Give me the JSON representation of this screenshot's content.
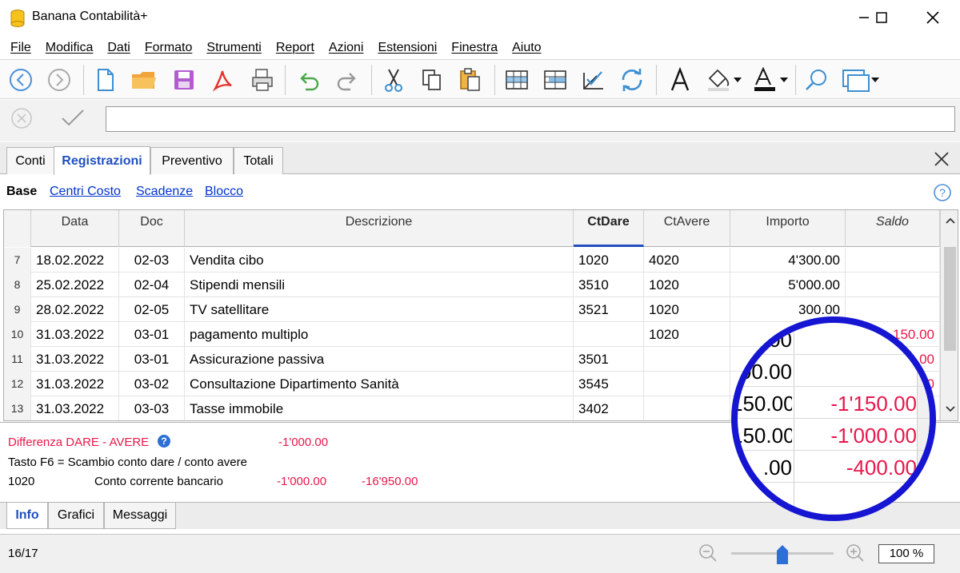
{
  "window": {
    "title": "Banana Contabilità+",
    "minimize_icon": "minimize-icon",
    "maximize_icon": "maximize-icon",
    "close_icon": "close-icon"
  },
  "menu": [
    "File",
    "Modifica",
    "Dati",
    "Formato",
    "Strumenti",
    "Report",
    "Azioni",
    "Estensioni",
    "Finestra",
    "Aiuto"
  ],
  "toolbar": {
    "icons": [
      "back-icon",
      "forward-icon",
      "new-file-icon",
      "open-folder-icon",
      "save-icon",
      "pdf-icon",
      "print-icon",
      "undo-icon",
      "redo-icon",
      "cut-icon",
      "copy-icon",
      "paste-icon",
      "insert-row-icon",
      "add-row-icon",
      "check-icon",
      "refresh-icon",
      "font-icon",
      "fill-color-icon",
      "text-color-icon",
      "search-icon",
      "window-menu-icon"
    ]
  },
  "editbar": {
    "cancel_icon": "cancel-icon",
    "confirm_icon": "confirm-icon",
    "value": ""
  },
  "tabs": [
    "Conti",
    "Registrazioni",
    "Preventivo",
    "Totali"
  ],
  "active_tab": "Registrazioni",
  "subviews": {
    "base": "Base",
    "links": [
      "Centri Costo",
      "Scadenze",
      "Blocco"
    ]
  },
  "columns": [
    "Data",
    "Doc",
    "Descrizione",
    "CtDare",
    "CtAvere",
    "Importo",
    "Saldo"
  ],
  "rows": [
    {
      "n": "7",
      "data": "18.02.2022",
      "doc": "02-03",
      "descr": "Vendita cibo",
      "dare": "1020",
      "avere": "4020",
      "importo": "4'300.00",
      "saldo": ""
    },
    {
      "n": "8",
      "data": "25.02.2022",
      "doc": "02-04",
      "descr": "Stipendi mensili",
      "dare": "3510",
      "avere": "1020",
      "importo": "5'000.00",
      "saldo": ""
    },
    {
      "n": "9",
      "data": "28.02.2022",
      "doc": "02-05",
      "descr": "TV satellitare",
      "dare": "3521",
      "avere": "1020",
      "importo": "300.00",
      "saldo": ""
    },
    {
      "n": "10",
      "data": "31.03.2022",
      "doc": "03-01",
      "descr": "pagamento multiplo",
      "dare": "",
      "avere": "1020",
      "importo": "",
      "saldo": "150.00"
    },
    {
      "n": "11",
      "data": "31.03.2022",
      "doc": "03-01",
      "descr": "Assicurazione passiva",
      "dare": "3501",
      "avere": "",
      "importo": "",
      "saldo": ".00"
    },
    {
      "n": "12",
      "data": "31.03.2022",
      "doc": "03-02",
      "descr": "Consultazione Dipartimento Sanità",
      "dare": "3545",
      "avere": "",
      "importo": "",
      "saldo": "0"
    },
    {
      "n": "13",
      "data": "31.03.2022",
      "doc": "03-03",
      "descr": "Tasse immobile",
      "dare": "3402",
      "avere": "",
      "importo": "",
      "saldo": ""
    }
  ],
  "magnifier": {
    "rows": [
      {
        "a": "00",
        "b": ""
      },
      {
        "a": "00.00",
        "b": ""
      },
      {
        "a": "150.00",
        "b": "-1'150.00"
      },
      {
        "a": "150.00",
        "b": "-1'000.00"
      },
      {
        "a": ".00",
        "b": "-400.00"
      },
      {
        "a": "",
        "b": ""
      }
    ]
  },
  "info": {
    "difference_label": "Differenza DARE - AVERE",
    "difference_value": "-1'000.00",
    "hint": "Tasto F6 = Scambio conto dare / conto avere",
    "account_code": "1020",
    "account_name": "Conto corrente bancario",
    "account_value1": "-1'000.00",
    "account_value2": "-16'950.00"
  },
  "bottom_tabs": [
    "Info",
    "Grafici",
    "Messaggi"
  ],
  "status": {
    "position": "16/17",
    "zoom": "100 %"
  },
  "colors": {
    "accent": "#1f4fbf",
    "negative": "#e8174a",
    "magnifier": "#1515d2",
    "link": "#0033cc"
  }
}
